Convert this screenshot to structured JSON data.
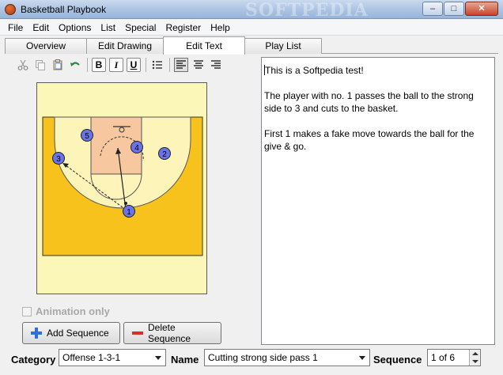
{
  "window": {
    "title": "Basketball Playbook",
    "watermark": "SOFTPEDIA",
    "minimize_glyph": "–",
    "maximize_glyph": "□",
    "close_glyph": "✕"
  },
  "menu": [
    "File",
    "Edit",
    "Options",
    "List",
    "Special",
    "Register",
    "Help"
  ],
  "tabs": [
    {
      "label": "Overview",
      "active": false
    },
    {
      "label": "Edit Drawing",
      "active": false
    },
    {
      "label": "Edit Text",
      "active": true
    },
    {
      "label": "Play List",
      "active": false
    }
  ],
  "toolbar": {
    "icons": [
      "cut-icon",
      "copy-icon",
      "paste-icon",
      "undo-icon",
      "bold-icon",
      "italic-icon",
      "underline-icon",
      "bullet-list-icon",
      "align-left-icon",
      "align-center-icon",
      "align-right-icon"
    ],
    "bold": "B",
    "italic": "I",
    "underline": "U"
  },
  "court": {
    "players": [
      {
        "number": "1"
      },
      {
        "number": "2"
      },
      {
        "number": "3"
      },
      {
        "number": "4"
      },
      {
        "number": "5"
      }
    ],
    "colors": {
      "paint": "#f7c7a0",
      "outside": "#f7c21b",
      "inside_arc": "#fcf4b8",
      "player": "#6a73e8"
    }
  },
  "editor": {
    "paragraphs": [
      "This is a Softpedia test!",
      "The player with no. 1 passes the ball to the strong side to 3 and cuts to the basket.",
      "First 1 makes a fake move towards the ball for the give & go."
    ]
  },
  "animation_only": {
    "label": "Animation only",
    "checked": false
  },
  "buttons": {
    "add_sequence": "Add Sequence",
    "delete_sequence": "Delete Sequence"
  },
  "bottom": {
    "category_label": "Category",
    "category_value": "Offense 1-3-1",
    "name_label": "Name",
    "name_value": "Cutting strong side pass 1",
    "sequence_label": "Sequence",
    "sequence_value": "1 of 6"
  }
}
